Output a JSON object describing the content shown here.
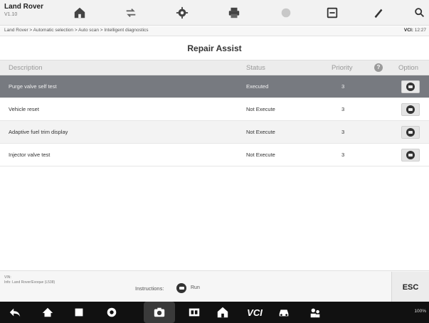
{
  "app": {
    "title": "Land Rover",
    "version": "V1.10"
  },
  "toolbar": {
    "icons": [
      "home-icon",
      "vehicle-swap-icon",
      "settings-icon",
      "print-icon",
      "help-icon",
      "save-icon",
      "edit-icon",
      "search-icon"
    ]
  },
  "breadcrumb": "Land Rover > Automatic selection > Auto scan > Intelligent diagnostics",
  "status_bar": {
    "vci_label": "VCI:",
    "time": "12:27"
  },
  "page": {
    "title": "Repair Assist"
  },
  "table": {
    "headers": {
      "description": "Description",
      "status": "Status",
      "priority": "Priority",
      "priority_help": "?",
      "option": "Option"
    },
    "rows": [
      {
        "description": "Purge valve self test",
        "status": "Executed",
        "priority": "3",
        "selected": true
      },
      {
        "description": "Vehicle reset",
        "status": "Not Execute",
        "priority": "3",
        "selected": false
      },
      {
        "description": "Adaptive fuel trim display",
        "status": "Not Execute",
        "priority": "3",
        "selected": false
      },
      {
        "description": "Injector valve test",
        "status": "Not Execute",
        "priority": "3",
        "selected": false
      }
    ]
  },
  "footer": {
    "vin_label": "VIN:",
    "vehicle": "Info: Land Rover/Evoque (L538)",
    "instructions_label": "Instructions:",
    "run_label": "Run",
    "esc_label": "ESC"
  },
  "navbar": {
    "vc_label": "VCI",
    "status": "100%"
  },
  "colors": {
    "selected_row": "#777a80",
    "header_bg": "#ececec",
    "navbar": "#111111"
  }
}
